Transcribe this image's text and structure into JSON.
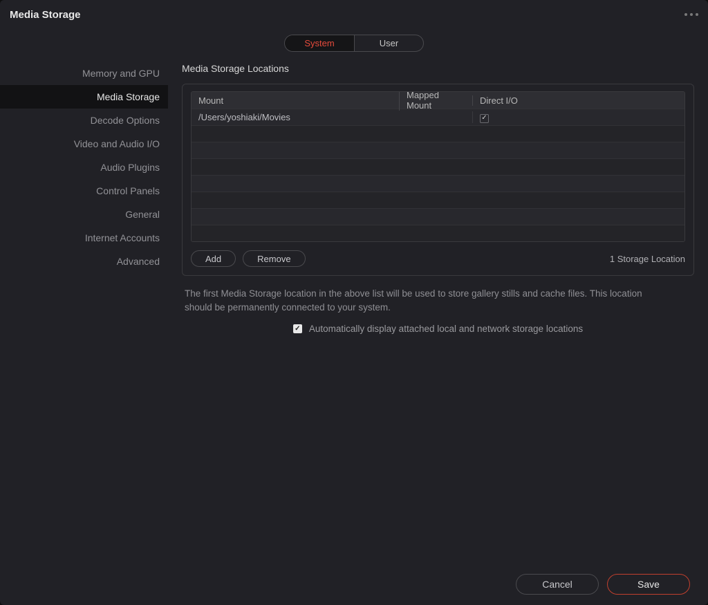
{
  "window": {
    "title": "Media Storage"
  },
  "tabs": {
    "system": "System",
    "user": "User",
    "active": "system"
  },
  "sidebar": {
    "items": [
      {
        "label": "Memory and GPU"
      },
      {
        "label": "Media Storage"
      },
      {
        "label": "Decode Options"
      },
      {
        "label": "Video and Audio I/O"
      },
      {
        "label": "Audio Plugins"
      },
      {
        "label": "Control Panels"
      },
      {
        "label": "General"
      },
      {
        "label": "Internet Accounts"
      },
      {
        "label": "Advanced"
      }
    ],
    "active_index": 1
  },
  "section": {
    "title": "Media Storage Locations"
  },
  "table": {
    "headers": {
      "mount": "Mount",
      "mapped": "Mapped Mount",
      "direct": "Direct I/O"
    },
    "rows": [
      {
        "mount": "/Users/yoshiaki/Movies",
        "mapped": "",
        "direct_io": true
      }
    ],
    "empty_rows": 7
  },
  "panel_buttons": {
    "add": "Add",
    "remove": "Remove"
  },
  "status": {
    "text": "1 Storage Location"
  },
  "help": {
    "text": "The first Media Storage location in the above list will be used to store gallery stills and cache files. This location should be permanently connected to your system."
  },
  "auto_display": {
    "checked": true,
    "label": "Automatically display attached local and network storage locations"
  },
  "footer": {
    "cancel": "Cancel",
    "save": "Save"
  }
}
